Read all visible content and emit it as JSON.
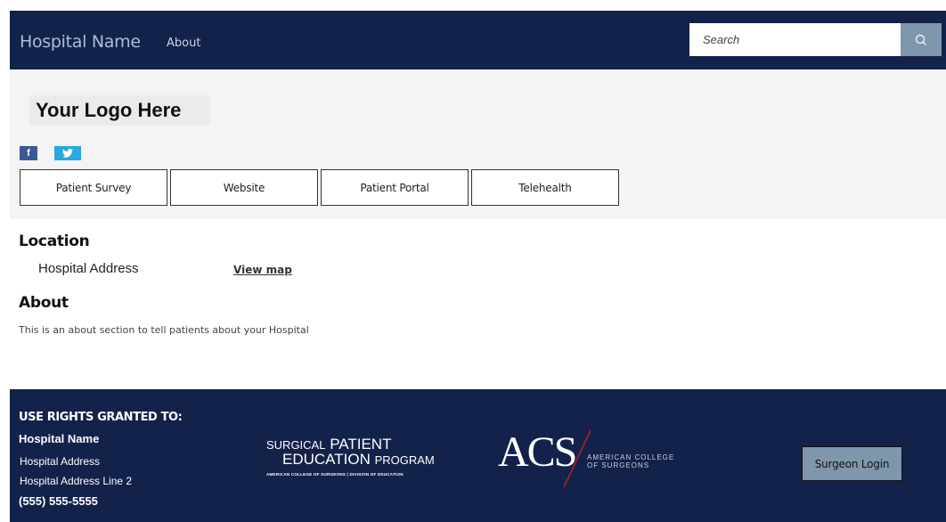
{
  "nav": {
    "brand": "Hospital Name",
    "about_link": "About",
    "search_placeholder": "Search",
    "search_icon": "search-icon"
  },
  "header": {
    "logo_text": "Your Logo Here",
    "social": [
      {
        "label": "f",
        "icon": "facebook-icon",
        "color": "#3b5998"
      },
      {
        "label": "ⓣ",
        "icon": "twitter-icon",
        "color": "#2aa8e0"
      }
    ],
    "buttons": [
      "Patient Survey",
      "Website",
      "Patient Portal",
      "Telehealth"
    ]
  },
  "location": {
    "title": "Location",
    "address": "Hospital Address",
    "map_link": "View map"
  },
  "about": {
    "title": "About",
    "text": "This is an about section to tell patients about your Hospital"
  },
  "footer": {
    "rights_label": "USE RIGHTS GRANTED TO:",
    "name": "Hospital Name",
    "address": "Hospital Address",
    "address2": "Hospital Address Line 2",
    "phone": "(555) 555-5555",
    "spep": {
      "line1_small_a": "SURGICAL",
      "line1_big": "PATIENT",
      "line2_big": "EDUCATION",
      "line2_small": "PROGRAM",
      "line3": "AMERICAN COLLEGE OF SURGEONS | DIVISION OF EDUCATION"
    },
    "acs": {
      "abbr": "ACS",
      "line1": "AMERICAN COLLEGE",
      "line2": "OF SURGEONS"
    },
    "login_button": "Surgeon Login"
  },
  "colors": {
    "navy": "#13224a",
    "accent_gray_blue": "#7f97ad",
    "header_band": "#f4f4f4"
  }
}
